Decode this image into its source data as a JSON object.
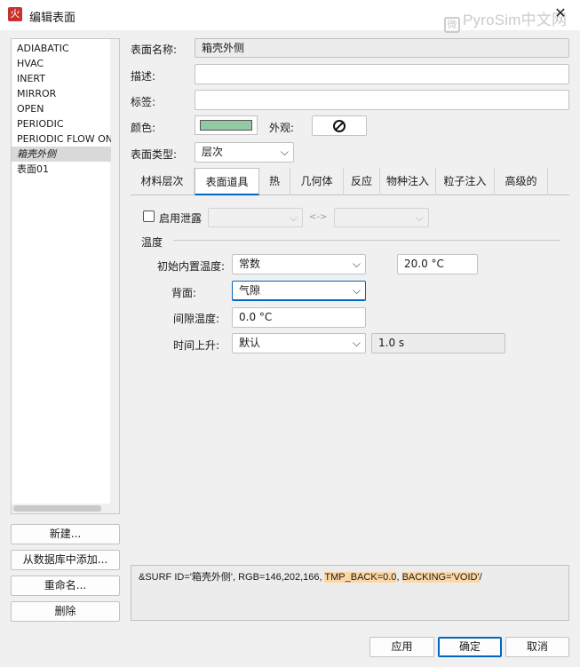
{
  "window": {
    "title": "编辑表面",
    "app_icon": "火",
    "watermark": "PyroSim中文网",
    "watermark_icon": "微"
  },
  "surface_list": {
    "items": [
      "ADIABATIC",
      "HVAC",
      "INERT",
      "MIRROR",
      "OPEN",
      "PERIODIC",
      "PERIODIC FLOW ONLY",
      "箱壳外侧",
      "表面01"
    ],
    "selected_index": 7
  },
  "left_buttons": {
    "new": "新建...",
    "add_from_db": "从数据库中添加...",
    "rename": "重命名...",
    "delete": "删除"
  },
  "form": {
    "name_label": "表面名称:",
    "name_value": "箱壳外侧",
    "desc_label": "描述:",
    "desc_value": "",
    "tag_label": "标签:",
    "tag_value": "",
    "color_label": "颜色:",
    "color_value": "#92caa6",
    "appearance_label": "外观:",
    "type_label": "表面类型:",
    "type_value": "层次"
  },
  "tabs": [
    "材料层次",
    "表面道具",
    "热",
    "几何体",
    "反应",
    "物种注入",
    "粒子注入",
    "高级的"
  ],
  "active_tab": 1,
  "leakage": {
    "label": "启用泄露",
    "arrow": "<->",
    "checked": false
  },
  "temperature": {
    "section_label": "温度",
    "initial_label": "初始内置温度:",
    "initial_mode": "常数",
    "initial_value": "20.0 °C",
    "back_label": "背面:",
    "back_value": "气隙",
    "gap_label": "间隙温度:",
    "gap_value": "0.0 °C",
    "ramp_label": "时间上升:",
    "ramp_mode": "默认",
    "ramp_value": "1.0 s"
  },
  "nml": {
    "prefix": "&SURF ID='箱壳外侧', RGB=146,202,166, ",
    "tmp_back": "TMP_BACK=0.0",
    "sep": ", ",
    "backing": "BACKING='VOID'",
    "suffix": "/"
  },
  "bottom_buttons": {
    "apply": "应用",
    "ok": "确定",
    "cancel": "取消"
  }
}
